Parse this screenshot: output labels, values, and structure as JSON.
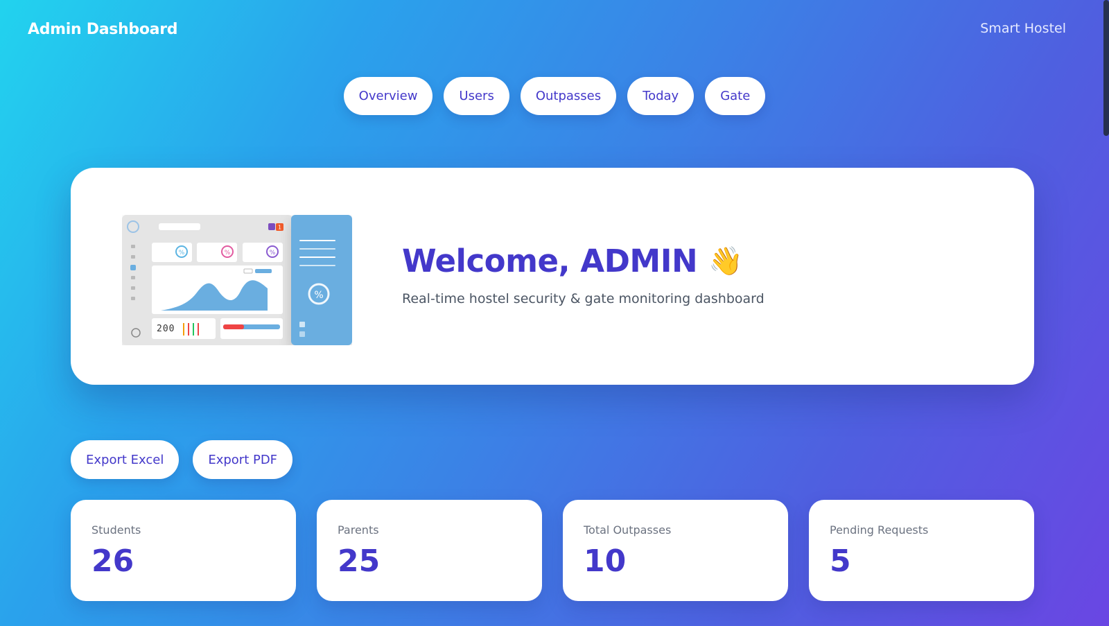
{
  "header": {
    "title": "Admin Dashboard",
    "app_name": "Smart Hostel"
  },
  "nav": {
    "tabs": [
      {
        "label": "Overview"
      },
      {
        "label": "Users"
      },
      {
        "label": "Outpasses"
      },
      {
        "label": "Today"
      },
      {
        "label": "Gate"
      }
    ]
  },
  "hero": {
    "welcome": "Welcome, ADMIN",
    "wave_emoji": "👋",
    "subtitle": "Real-time hostel security & gate monitoring dashboard",
    "illustration": {
      "percent_symbol": "%",
      "counter_text": "200",
      "badge_count": "1"
    }
  },
  "actions": {
    "export_excel": "Export Excel",
    "export_pdf": "Export PDF"
  },
  "stats": [
    {
      "label": "Students",
      "value": "26"
    },
    {
      "label": "Parents",
      "value": "25"
    },
    {
      "label": "Total Outpasses",
      "value": "10"
    },
    {
      "label": "Pending Requests",
      "value": "5"
    }
  ],
  "colors": {
    "accent": "#4338ca",
    "gradient_start": "#22d3ee",
    "gradient_end": "#6a46e3",
    "illustration_blue": "#6aaee0",
    "illustration_red": "#ef4444"
  }
}
